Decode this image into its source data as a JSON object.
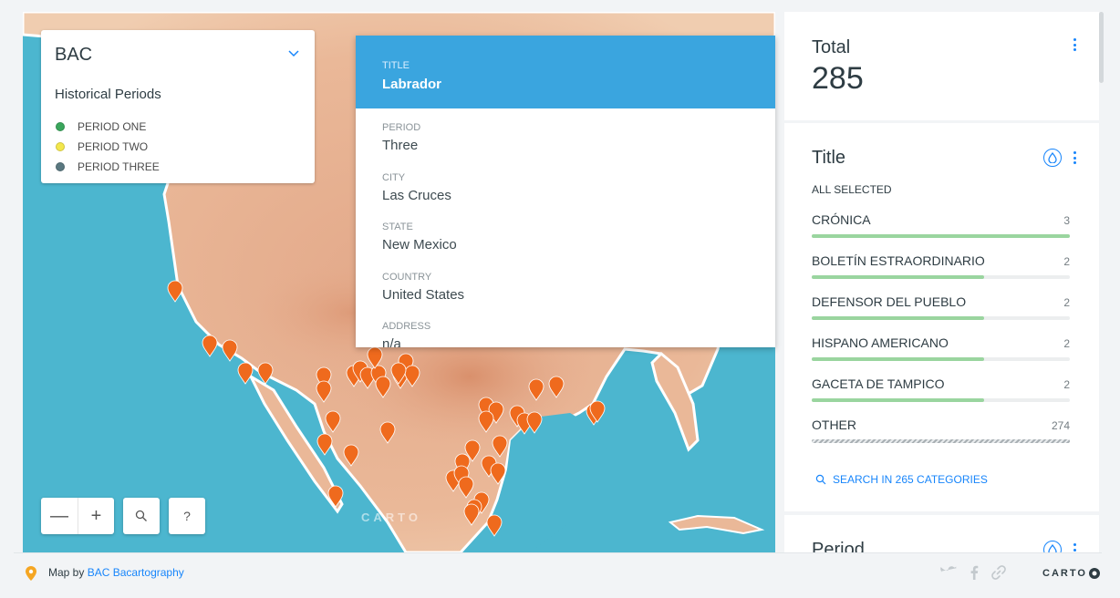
{
  "legend": {
    "title": "BAC",
    "subtitle": "Historical Periods",
    "items": [
      {
        "label": "PERIOD ONE",
        "color": "#3aa65c"
      },
      {
        "label": "PERIOD TWO",
        "color": "#f3e74c"
      },
      {
        "label": "PERIOD THREE",
        "color": "#5a7880"
      }
    ]
  },
  "popup": {
    "title_label": "TITLE",
    "title_value": "Labrador",
    "fields": [
      {
        "label": "PERIOD",
        "value": "Three"
      },
      {
        "label": "CITY",
        "value": "Las Cruces"
      },
      {
        "label": "STATE",
        "value": "New Mexico"
      },
      {
        "label": "COUNTRY",
        "value": "United States"
      },
      {
        "label": "ADDRESS",
        "value": "n/a"
      }
    ]
  },
  "map_controls": {
    "zoom_out": "—",
    "zoom_in": "+",
    "search_icon": "search-icon",
    "help": "?",
    "watermark": "CARTO"
  },
  "widgets": {
    "total": {
      "title": "Total",
      "value": "285"
    },
    "title_widget": {
      "title": "Title",
      "status": "ALL SELECTED",
      "categories": [
        {
          "name": "CRÓNICA",
          "count": 3,
          "ratio": 1.0
        },
        {
          "name": "BOLETÍN ESTRAORDINARIO",
          "count": 2,
          "ratio": 0.667
        },
        {
          "name": "DEFENSOR DEL PUEBLO",
          "count": 2,
          "ratio": 0.667
        },
        {
          "name": "HISPANO AMERICANO",
          "count": 2,
          "ratio": 0.667
        },
        {
          "name": "GACETA DE TAMPICO",
          "count": 2,
          "ratio": 0.667
        },
        {
          "name": "OTHER",
          "count": 274,
          "ratio": 1.0
        }
      ],
      "search_label": "SEARCH IN 265 CATEGORIES"
    },
    "period_widget": {
      "title": "Period"
    }
  },
  "footer": {
    "map_by": "Map by",
    "author": "BAC Bacartography",
    "logo": "CARTO"
  },
  "colors": {
    "accent": "#1785fb",
    "popup_header": "#3aa5df",
    "marker": "#ef6a1d",
    "bar_fill": "#9ad59f"
  }
}
